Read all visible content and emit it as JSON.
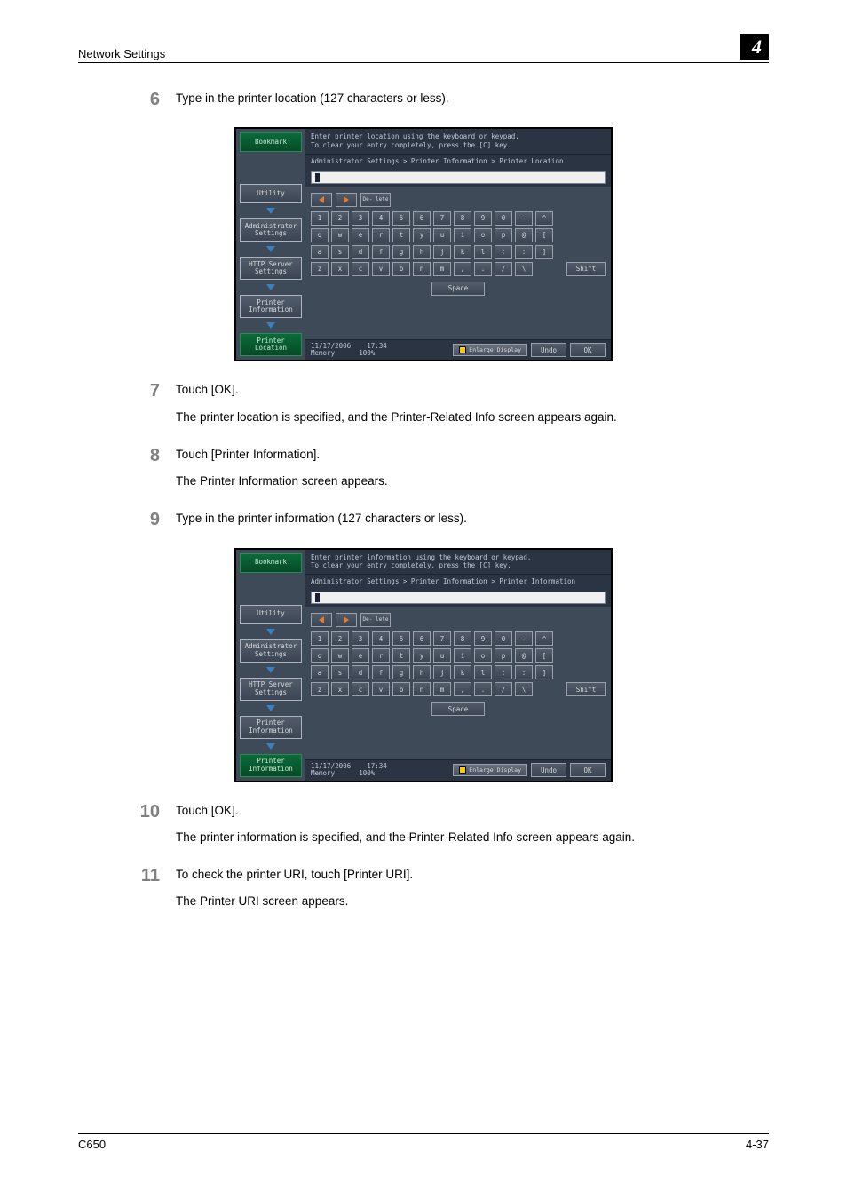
{
  "header": {
    "section": "Network Settings",
    "chapter": "4"
  },
  "footer": {
    "model": "C650",
    "pagenum": "4-37"
  },
  "steps": {
    "6": {
      "num": "6",
      "a": "Type in the printer location (127 characters or less)."
    },
    "7": {
      "num": "7",
      "a": "Touch [OK].",
      "b": "The printer location is specified, and the Printer-Related Info screen appears again."
    },
    "8": {
      "num": "8",
      "a": "Touch [Printer Information].",
      "b": "The Printer Information screen appears."
    },
    "9": {
      "num": "9",
      "a": "Type in the printer information (127 characters or less)."
    },
    "10": {
      "num": "10",
      "a": "Touch [OK].",
      "b": "The printer information is specified, and the Printer-Related Info screen appears again."
    },
    "11": {
      "num": "11",
      "a": "To check the printer URI, touch [Printer URI].",
      "b": "The Printer URI screen appears."
    }
  },
  "panel": {
    "sidebar": {
      "bookmark": "Bookmark",
      "utility": "Utility",
      "admin": "Administrator Settings",
      "http": "HTTP Server Settings",
      "printerinfo": "Printer Information"
    },
    "hdr1": "Enter printer location using the keyboard or keypad.",
    "hdr1b": "Enter printer information using the keyboard or keypad.",
    "hdr2": "To clear your entry completely, press the [C] key.",
    "crumbA": "Administrator Settings > Printer Information > Printer Location",
    "crumbB": "Administrator Settings > Printer Information > Printer Information",
    "lastA": "Printer Location",
    "lastB": "Printer Information",
    "del": "De- lete",
    "rows": {
      "r1": [
        "1",
        "2",
        "3",
        "4",
        "5",
        "6",
        "7",
        "8",
        "9",
        "0",
        "-",
        "^"
      ],
      "r2": [
        "q",
        "w",
        "e",
        "r",
        "t",
        "y",
        "u",
        "i",
        "o",
        "p",
        "@",
        "["
      ],
      "r3": [
        "a",
        "s",
        "d",
        "f",
        "g",
        "h",
        "j",
        "k",
        "l",
        ";",
        ":",
        "]"
      ],
      "r4": [
        "z",
        "x",
        "c",
        "v",
        "b",
        "n",
        "m",
        ",",
        ".",
        "/",
        "\\"
      ]
    },
    "shift": "Shift",
    "space": "Space",
    "date": "11/17/2006",
    "time": "17:34",
    "mem": "Memory",
    "mempc": "100%",
    "enlarge": "Enlarge Display",
    "undo": "Undo",
    "ok": "OK"
  }
}
